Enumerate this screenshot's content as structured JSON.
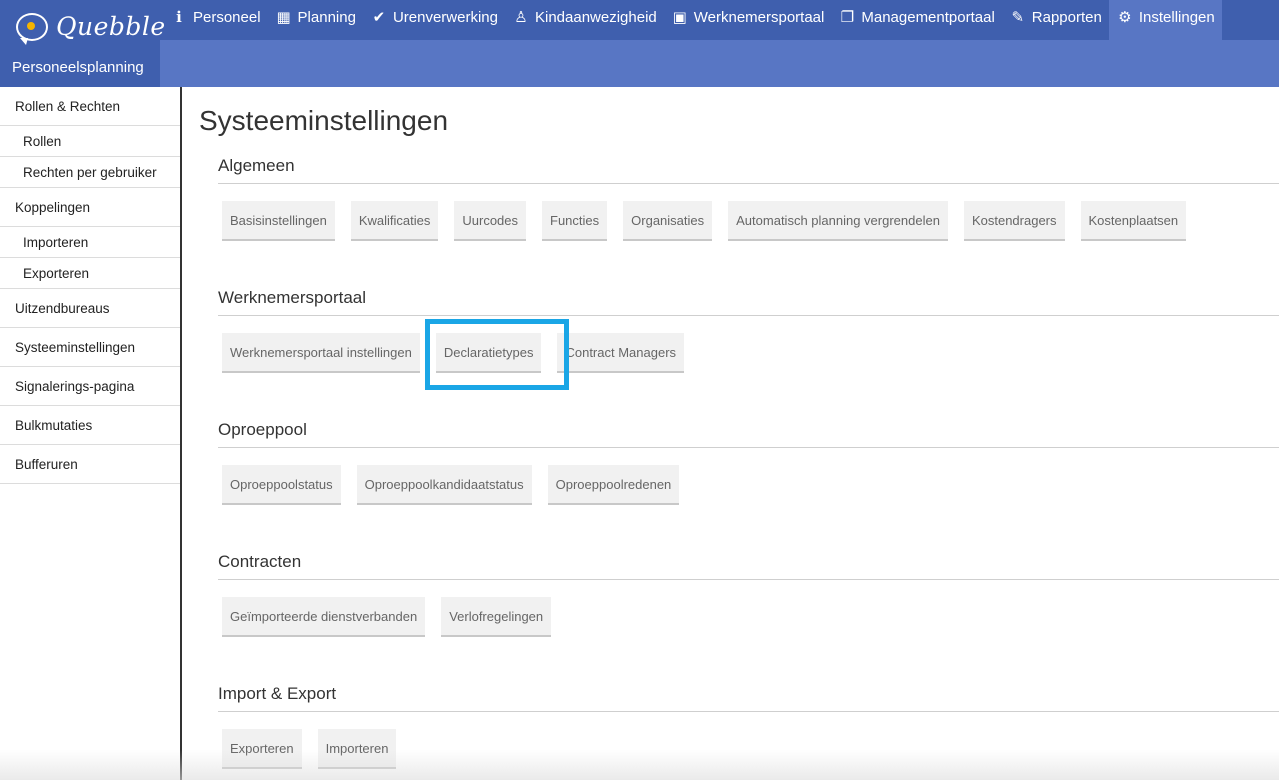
{
  "app": {
    "logo_text": "Quebble",
    "name": "Personeelsplanning"
  },
  "nav": [
    {
      "label": "Personeel",
      "icon": "info-icon",
      "glyph": "ℹ"
    },
    {
      "label": "Planning",
      "icon": "calendar-icon",
      "glyph": "▦"
    },
    {
      "label": "Urenverwerking",
      "icon": "check-icon",
      "glyph": "✔"
    },
    {
      "label": "Kindaanwezigheid",
      "icon": "child-icon",
      "glyph": "♙"
    },
    {
      "label": "Werknemersportaal",
      "icon": "briefcase-icon",
      "glyph": "▣"
    },
    {
      "label": "Managementportaal",
      "icon": "copy-icon",
      "glyph": "❐"
    },
    {
      "label": "Rapporten",
      "icon": "paperclip-icon",
      "glyph": "✎"
    },
    {
      "label": "Instellingen",
      "icon": "gear-icon",
      "glyph": "⚙"
    }
  ],
  "sidebar": {
    "items": [
      {
        "label": "Rollen & Rechten",
        "type": "item"
      },
      {
        "label": "Rollen",
        "type": "sub"
      },
      {
        "label": "Rechten per gebruiker",
        "type": "sub"
      },
      {
        "label": "Koppelingen",
        "type": "item"
      },
      {
        "label": "Importeren",
        "type": "sub"
      },
      {
        "label": "Exporteren",
        "type": "sub"
      },
      {
        "label": "Uitzendbureaus",
        "type": "item"
      },
      {
        "label": "Systeeminstellingen",
        "type": "item"
      },
      {
        "label": "Signalerings-pagina",
        "type": "item"
      },
      {
        "label": "Bulkmutaties",
        "type": "item"
      },
      {
        "label": "Bufferuren",
        "type": "item"
      }
    ]
  },
  "main": {
    "title": "Systeeminstellingen",
    "sections": [
      {
        "title": "Algemeen",
        "buttons": [
          "Basisinstellingen",
          "Kwalificaties",
          "Uurcodes",
          "Functies",
          "Organisaties",
          "Automatisch planning vergrendelen",
          "Kostendragers",
          "Kostenplaatsen"
        ]
      },
      {
        "title": "Werknemersportaal",
        "buttons": [
          "Werknemersportaal instellingen",
          "Declaratietypes",
          "Contract Managers"
        ]
      },
      {
        "title": "Oproeppool",
        "buttons": [
          "Oproeppoolstatus",
          "Oproeppoolkandidaatstatus",
          "Oproeppoolredenen"
        ]
      },
      {
        "title": "Contracten",
        "buttons": [
          "Geïmporteerde dienstverbanden",
          "Verlofregelingen"
        ]
      },
      {
        "title": "Import & Export",
        "buttons": [
          "Exporteren",
          "Importeren"
        ]
      }
    ]
  },
  "colors": {
    "nav_bg": "#3f5fae",
    "subnav_bg": "#5876c4",
    "highlight": "#1aa6e6"
  }
}
